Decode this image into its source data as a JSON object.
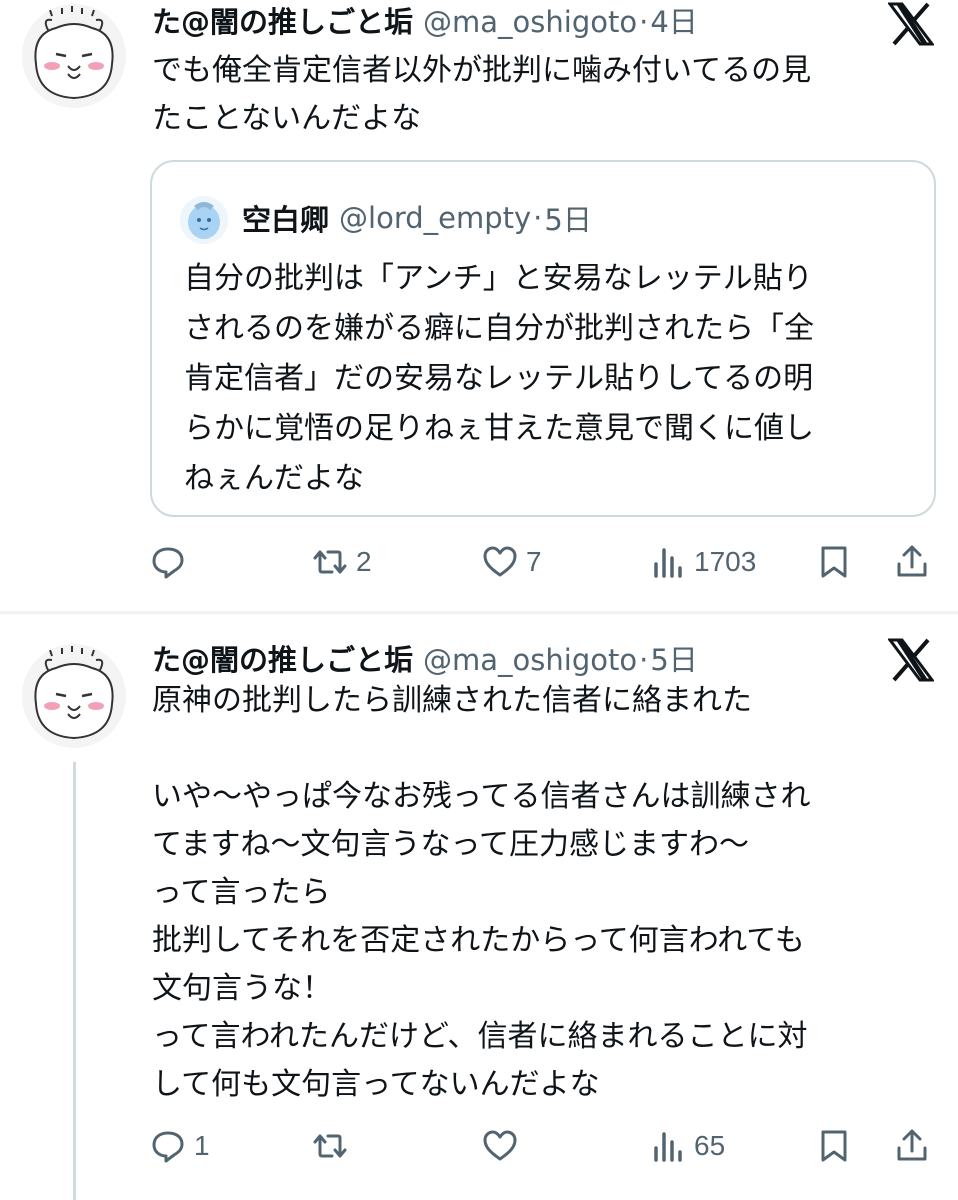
{
  "posts": [
    {
      "author_name": "た@闇の推しごと垢",
      "handle": "@ma_oshigoto",
      "separator": "·",
      "time": "4日",
      "text": "でも俺全肯定信者以外が批判に噛み付いてるの見\nたことないんだよな",
      "quote": {
        "author_name": "空白卿",
        "handle": "@lord_empty",
        "separator": "·",
        "time": "5日",
        "text": "自分の批判は「アンチ」と安易なレッテル貼り\nされるのを嫌がる癖に自分が批判されたら「全\n肯定信者」だの安易なレッテル貼りしてるの明\nらかに覚悟の足りねぇ甘えた意見で聞くに値し\nねぇんだよな"
      },
      "actions": {
        "reply_count": "",
        "repost_count": "2",
        "like_count": "7",
        "view_count": "1703"
      }
    },
    {
      "author_name": "た@闇の推しごと垢",
      "handle": "@ma_oshigoto",
      "separator": "·",
      "time": "5日",
      "text": "原神の批判したら訓練された信者に絡まれた\n\nいや〜やっぱ今なお残ってる信者さんは訓練され\nてますね〜文句言うなって圧力感じますわ〜\nって言ったら\n批判してそれを否定されたからって何言われても\n文句言うな！\nって言われたんだけど、信者に絡まれることに対\nして何も文句言ってないんだよな",
      "actions": {
        "reply_count": "1",
        "repost_count": "",
        "like_count": "",
        "view_count": "65"
      }
    }
  ],
  "icons": {
    "platform_logo": "x-logo-icon",
    "reply": "reply-icon",
    "repost": "repost-icon",
    "like": "heart-icon",
    "views": "views-icon",
    "bookmark": "bookmark-icon",
    "share": "share-icon"
  },
  "colors": {
    "text_primary": "#0f1419",
    "text_secondary": "#536471",
    "border": "#cfd9de",
    "divider": "#eff3f4"
  }
}
